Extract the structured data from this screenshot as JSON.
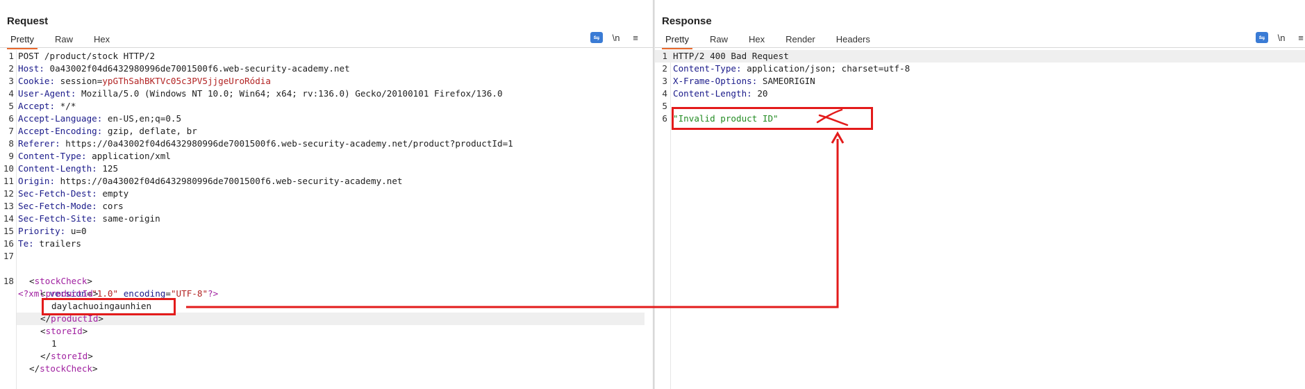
{
  "request": {
    "title": "Request",
    "tabs": [
      "Pretty",
      "Raw",
      "Hex"
    ],
    "active_tab": "Pretty",
    "lines": [
      {
        "n": "1",
        "key": "",
        "val": "POST /product/stock HTTP/2"
      },
      {
        "n": "2",
        "key": "Host:",
        "val": " 0a43002f04d6432980996de7001500f6.web-security-academy.net"
      },
      {
        "n": "3",
        "key": "Cookie:",
        "val": " session=",
        "cookie": "ypGThSahBKTVc05c3PV5jjgeUroRódia"
      },
      {
        "n": "4",
        "key": "User-Agent:",
        "val": " Mozilla/5.0 (Windows NT 10.0; Win64; x64; rv:136.0) Gecko/20100101 Firefox/136.0"
      },
      {
        "n": "5",
        "key": "Accept:",
        "val": " */*"
      },
      {
        "n": "6",
        "key": "Accept-Language:",
        "val": " en-US,en;q=0.5"
      },
      {
        "n": "7",
        "key": "Accept-Encoding:",
        "val": " gzip, deflate, br"
      },
      {
        "n": "8",
        "key": "Referer:",
        "val": " https://0a43002f04d6432980996de7001500f6.web-security-academy.net/product?productId=1"
      },
      {
        "n": "9",
        "key": "Content-Type:",
        "val": " application/xml"
      },
      {
        "n": "10",
        "key": "Content-Length:",
        "val": " 125"
      },
      {
        "n": "11",
        "key": "Origin:",
        "val": " https://0a43002f04d6432980996de7001500f6.web-security-academy.net"
      },
      {
        "n": "12",
        "key": "Sec-Fetch-Dest:",
        "val": " empty"
      },
      {
        "n": "13",
        "key": "Sec-Fetch-Mode:",
        "val": " cors"
      },
      {
        "n": "14",
        "key": "Sec-Fetch-Site:",
        "val": " same-origin"
      },
      {
        "n": "15",
        "key": "Priority:",
        "val": " u=0"
      },
      {
        "n": "16",
        "key": "Te:",
        "val": " trailers"
      },
      {
        "n": "17",
        "key": "",
        "val": ""
      }
    ],
    "xml": {
      "line_no": "18",
      "decl_open": "<?",
      "decl_name": "xml",
      "version_attr": "version",
      "version_val": "\"1.0\"",
      "encoding_attr": "encoding",
      "encoding_val": "\"UTF-8\"",
      "decl_close": "?>",
      "stockcheck": "stockCheck",
      "productid": "productId",
      "productid_value": "daylachuoingaunhien",
      "storeid": "storeId",
      "storeid_value": "1"
    }
  },
  "response": {
    "title": "Response",
    "tabs": [
      "Pretty",
      "Raw",
      "Hex",
      "Render",
      "Headers"
    ],
    "active_tab": "Pretty",
    "lines": [
      {
        "n": "1",
        "key": "",
        "val": "HTTP/2 400 Bad Request"
      },
      {
        "n": "2",
        "key": "Content-Type:",
        "val": " application/json; charset=utf-8"
      },
      {
        "n": "3",
        "key": "X-Frame-Options:",
        "val": " SAMEORIGIN"
      },
      {
        "n": "4",
        "key": "Content-Length:",
        "val": " 20"
      },
      {
        "n": "5",
        "key": "",
        "val": ""
      },
      {
        "n": "6",
        "key": "",
        "val": "\"Invalid product ID\""
      }
    ]
  },
  "toolbar": {
    "newline_label": "\\n",
    "menu_label": "≡",
    "wrap_label": "⇋"
  },
  "colors": {
    "accent": "#e8692d",
    "annotation": "#e31b1b",
    "active_blue": "#3a7bd5"
  }
}
